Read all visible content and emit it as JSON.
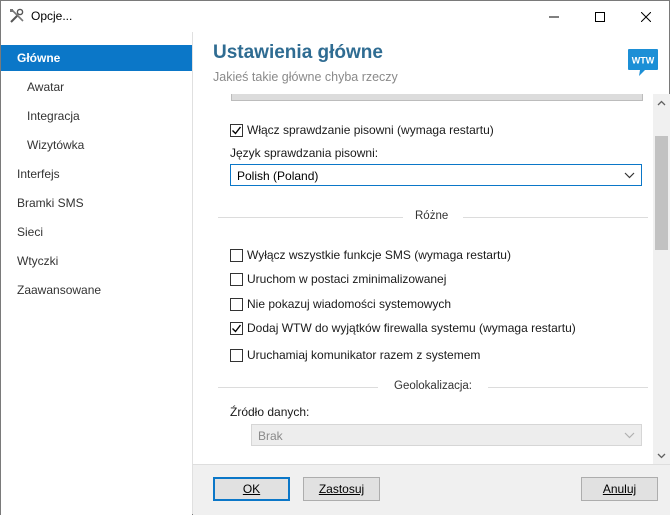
{
  "window": {
    "title": "Opcje..."
  },
  "sidebar": {
    "items": [
      {
        "label": "Główne",
        "active": true
      },
      {
        "label": "Awatar"
      },
      {
        "label": "Integracja"
      },
      {
        "label": "Wizytówka"
      },
      {
        "label": "Interfejs"
      },
      {
        "label": "Bramki SMS"
      },
      {
        "label": "Sieci"
      },
      {
        "label": "Wtyczki"
      },
      {
        "label": "Zaawansowane"
      }
    ]
  },
  "header": {
    "title": "Ustawienia główne",
    "subtitle": "Jakieś takie główne chyba rzeczy",
    "logo_text": "WTW"
  },
  "content": {
    "spellcheck": {
      "label": "Włącz sprawdzanie pisowni (wymaga restartu)",
      "checked": true
    },
    "spell_lang_label": "Język sprawdzania pisowni:",
    "spell_lang_value": "Polish (Poland)",
    "section_misc": "Różne",
    "options": [
      {
        "label": "Wyłącz wszystkie funkcje SMS (wymaga restartu)",
        "checked": false
      },
      {
        "label": "Uruchom w postaci zminimalizowanej",
        "checked": false
      },
      {
        "label": "Nie pokazuj wiadomości systemowych",
        "checked": false
      },
      {
        "label": "Dodaj WTW do wyjątków firewalla systemu (wymaga restartu)",
        "checked": true
      },
      {
        "label": "Uruchamiaj komunikator razem z systemem",
        "checked": false
      }
    ],
    "section_geo": "Geolokalizacja:",
    "geo_source_label": "Źródło danych:",
    "geo_source_value": "Brak"
  },
  "footer": {
    "ok": "OK",
    "apply": "Zastosuj",
    "cancel": "Anuluj"
  },
  "colors": {
    "accent": "#0b77c8",
    "title": "#2f6c92"
  }
}
